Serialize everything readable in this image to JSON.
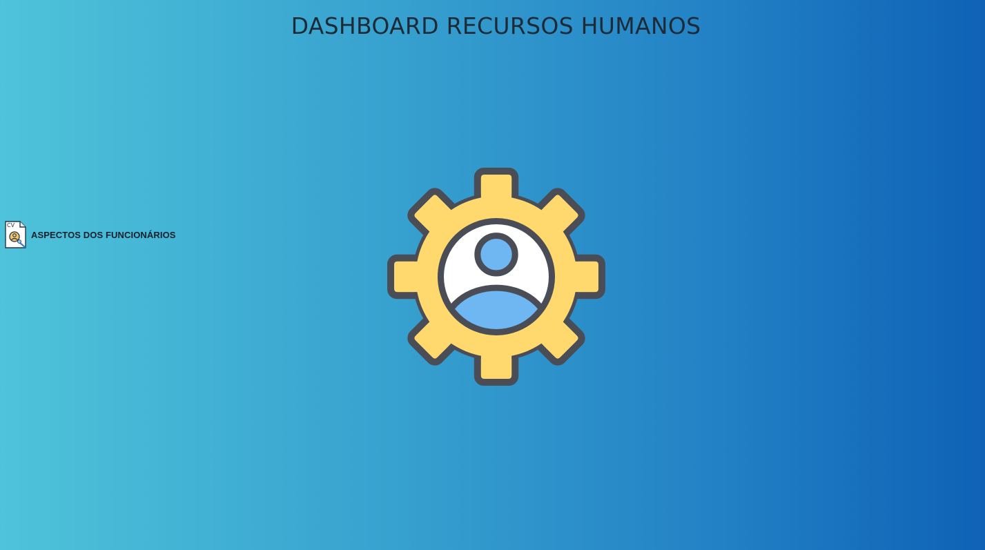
{
  "header": {
    "title": "DASHBOARD RECURSOS HUMANOS"
  },
  "nav": {
    "items": [
      {
        "label": "ASPECTOS DOS FUNCIONÁRIOS",
        "icon": "cv-document-icon",
        "icon_text": "CV"
      }
    ]
  },
  "hero": {
    "icon": "gear-user-icon"
  },
  "colors": {
    "background_start": "#4ec3da",
    "background_end": "#0f62b6",
    "gear_fill": "#ffd86e",
    "gear_stroke": "#4a4d55",
    "user_fill": "#6fb7f2",
    "title_color": "#1d2b38"
  }
}
